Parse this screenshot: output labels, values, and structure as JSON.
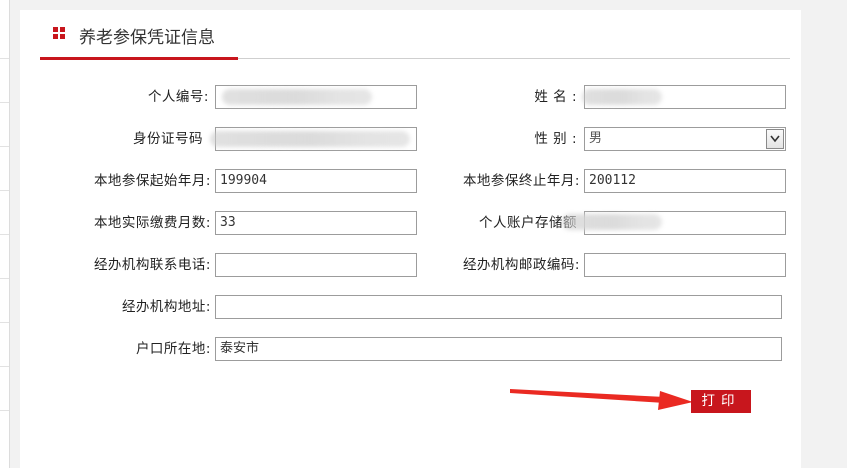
{
  "header": {
    "title": "养老参保凭证信息"
  },
  "form": {
    "personal_id": {
      "label": "个人编号:",
      "value": ""
    },
    "name": {
      "label": "姓 名 :",
      "value": ""
    },
    "id_card": {
      "label": "身份证号码",
      "value": ""
    },
    "gender": {
      "label": "性 别 :",
      "value": "男"
    },
    "insured_start": {
      "label": "本地参保起始年月:",
      "value": "199904"
    },
    "insured_end": {
      "label": "本地参保终止年月:",
      "value": "200112"
    },
    "months_paid": {
      "label": "本地实际缴费月数:",
      "value": "33"
    },
    "account_balance": {
      "label": "个人账户存储额",
      "value": ""
    },
    "agency_phone": {
      "label": "经办机构联系电话:",
      "value": ""
    },
    "agency_postcode": {
      "label": "经办机构邮政编码:",
      "value": ""
    },
    "agency_address": {
      "label": "经办机构地址:",
      "value": ""
    },
    "hukou_location": {
      "label": "户口所在地:",
      "value": "泰安市"
    }
  },
  "actions": {
    "print_label": "打印"
  },
  "colors": {
    "accent": "#c8161d",
    "field_border": "#9c9c9c",
    "background": "#f2f2f2"
  },
  "icons": {
    "header": "grid-squares-icon",
    "select": "chevron-down-icon",
    "annotation": "red-arrow-icon"
  }
}
